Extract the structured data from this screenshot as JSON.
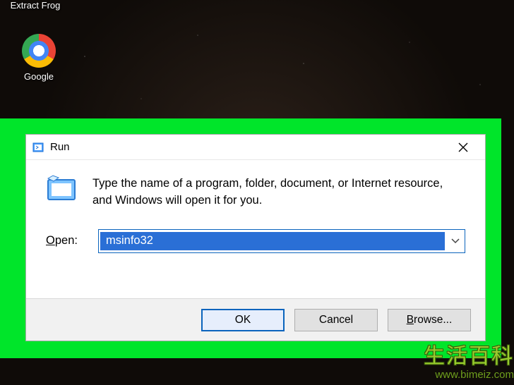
{
  "desktop": {
    "icons": {
      "extract_frog": "Extract Frog",
      "chrome": "Google"
    }
  },
  "run": {
    "title": "Run",
    "description": "Type the name of a program, folder, document, or Internet resource, and Windows will open it for you.",
    "open_label_prefix": "O",
    "open_label_rest": "pen:",
    "input_value": "msinfo32",
    "buttons": {
      "ok": "OK",
      "cancel": "Cancel",
      "browse_prefix": "B",
      "browse_rest": "rowse..."
    }
  },
  "watermark": {
    "text": "生活百科",
    "url": "www.bimeiz.com"
  }
}
